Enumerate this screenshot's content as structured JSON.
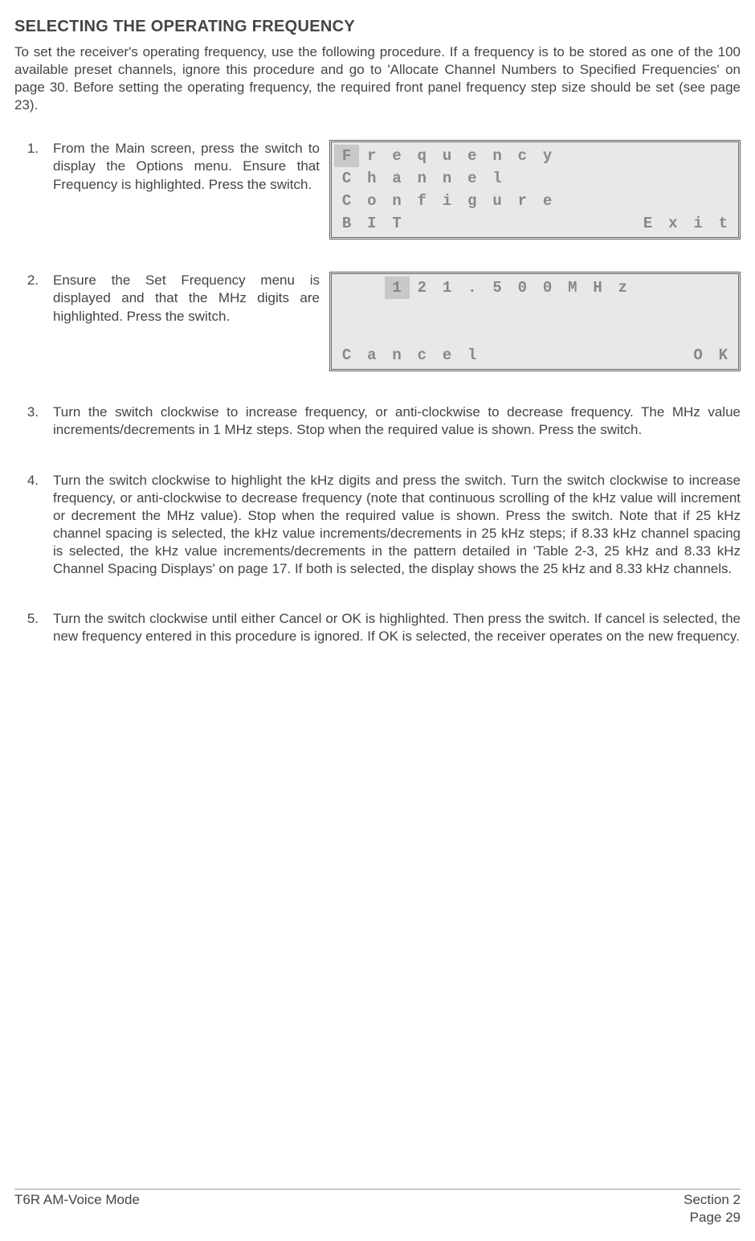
{
  "heading": "SELECTING THE OPERATING FREQUENCY",
  "intro": "To set the receiver's operating frequency, use the following procedure. If a frequency is to be stored as one of the 100 available preset channels, ignore this procedure and go to  'Allocate Channel Numbers to Specified Frequencies' on page 30. Before setting the operating frequency, the required front panel frequency step size should be set (see page 23).",
  "steps": {
    "s1": {
      "num": "1.",
      "text": "From the Main screen, press the switch to display the Options menu. Ensure that Frequency is highlighted. Press the switch."
    },
    "s2": {
      "num": "2.",
      "text": "Ensure the Set Frequency menu is displayed and that the MHz digits are highlighted. Press the switch."
    },
    "s3": {
      "num": "3.",
      "text": "Turn the switch clockwise to increase frequency, or anti-clockwise to decrease frequency. The MHz value increments/decrements in 1 MHz steps. Stop when the required value is shown. Press the switch."
    },
    "s4": {
      "num": "4.",
      "text": "Turn the switch clockwise to highlight the kHz digits and press the switch. Turn the switch clockwise to increase frequency, or anti-clockwise to decrease frequency (note that continuous scrolling of the kHz value will increment or decrement the MHz value). Stop when the required value is shown. Press the switch. Note that if 25 kHz channel spacing is selected, the kHz value increments/decrements in 25 kHz steps; if 8.33 kHz channel spacing is selected, the kHz value increments/decrements in the pattern detailed in 'Table 2-3, 25 kHz and 8.33 kHz Channel Spacing Displays' on page 17. If both is selected, the display shows the 25 kHz and 8.33 kHz channels."
    },
    "s5": {
      "num": "5.",
      "text": "Turn the switch clockwise until either Cancel or OK is highlighted. Then press the switch. If cancel is selected, the new frequency entered in this procedure is ignored. If OK is selected, the receiver operates on the new frequency."
    }
  },
  "lcd1": {
    "r1": [
      "F",
      "r",
      "e",
      "q",
      "u",
      "e",
      "n",
      "c",
      "y",
      "",
      "",
      "",
      "",
      "",
      "",
      ""
    ],
    "r2": [
      "C",
      "h",
      "a",
      "n",
      "n",
      "e",
      "l",
      "",
      "",
      "",
      "",
      "",
      "",
      "",
      "",
      ""
    ],
    "r3": [
      "C",
      "o",
      "n",
      "f",
      "i",
      "g",
      "u",
      "r",
      "e",
      "",
      "",
      "",
      "",
      "",
      "",
      ""
    ],
    "r4": [
      "B",
      "I",
      "T",
      "",
      "",
      "",
      "",
      "",
      "",
      "",
      "",
      "",
      "E",
      "x",
      "i",
      "t"
    ]
  },
  "lcd2": {
    "r1": [
      "",
      "",
      "1",
      "2",
      "1",
      ".",
      "5",
      "0",
      "0",
      "M",
      "H",
      "z",
      "",
      "",
      "",
      ""
    ],
    "r4": [
      "C",
      "a",
      "n",
      "c",
      "e",
      "l",
      "",
      "",
      "",
      "",
      "",
      "",
      "",
      "",
      "O",
      "K"
    ]
  },
  "footer": {
    "left": "T6R AM-Voice Mode",
    "right1": "Section 2",
    "right2": "Page 29"
  }
}
